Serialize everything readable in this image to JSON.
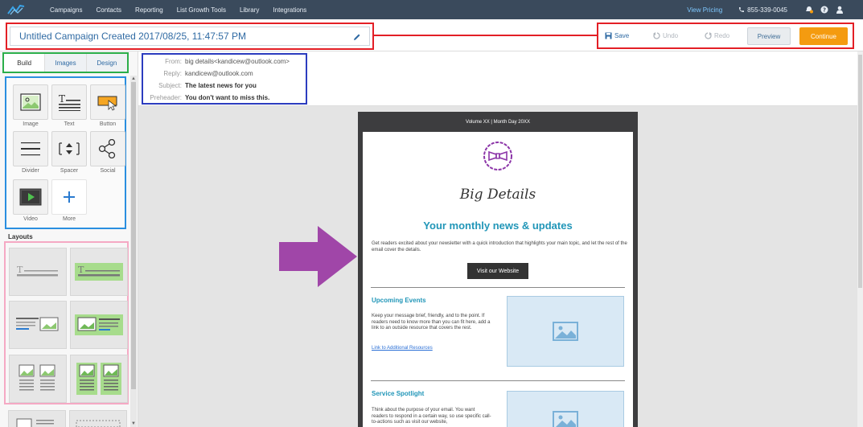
{
  "nav": {
    "items": [
      "Campaigns",
      "Contacts",
      "Reporting",
      "List Growth Tools",
      "Library",
      "Integrations"
    ],
    "pricing": "View Pricing",
    "phone": "855-339-0045"
  },
  "toolbar": {
    "campaign_title": "Untitled Campaign Created 2017/08/25, 11:47:57 PM",
    "save": "Save",
    "undo": "Undo",
    "redo": "Redo",
    "preview": "Preview",
    "continue": "Continue"
  },
  "sidebar": {
    "tabs": [
      "Build",
      "Images",
      "Design"
    ],
    "blocks": [
      "Image",
      "Text",
      "Button",
      "Divider",
      "Spacer",
      "Social",
      "Video",
      "More"
    ],
    "layouts_title": "Layouts"
  },
  "header": {
    "from_label": "From:",
    "from_value": "big details<kandicew@outlook.com>",
    "reply_label": "Reply:",
    "reply_value": "kandicew@outlook.com",
    "subject_label": "Subject:",
    "subject_value": "The latest news for you",
    "preheader_label": "Preheader:",
    "preheader_value": "You don't want to miss this."
  },
  "email": {
    "volume": "Volume XX | Month Day 20XX",
    "brand": "Big Details",
    "headline": "Your monthly news & updates",
    "intro": "Get readers excited about your newsletter with a quick introduction that highlights your main topic, and let the rest of the email cover the details.",
    "cta": "Visit our Website",
    "section1_title": "Upcoming Events",
    "section1_body": "Keep your message brief, friendly, and to the point. If readers need to know more than you can fit here, add a link to an outside resource that covers the rest.",
    "section1_link": "Link to Additional Resources",
    "section2_title": "Service Spotlight",
    "section2_body": "Think about the purpose of your email. You want readers to respond in a certain way, so use specific call-to-actions such as visit our website,"
  },
  "colors": {
    "nav_bg": "#3a4a5c",
    "accent": "#2196b8",
    "continue": "#f49b10",
    "annotation_red": "#e31f26",
    "annotation_green": "#2bae4a",
    "annotation_blue": "#2a8fe0",
    "annotation_navy": "#2c3cbf",
    "annotation_pink": "#f5a9c4",
    "arrow_purple": "#a046a8"
  }
}
